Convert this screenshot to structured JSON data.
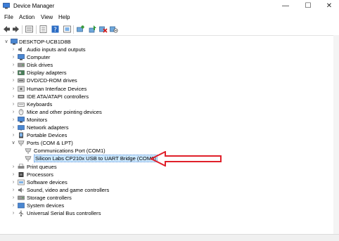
{
  "window": {
    "title": "Device Manager"
  },
  "menu": [
    "File",
    "Action",
    "View",
    "Help"
  ],
  "tree": {
    "root": "DESKTOP-UCB1D8B",
    "categories": [
      {
        "label": "Audio inputs and outputs",
        "icon": "speaker-icon"
      },
      {
        "label": "Computer",
        "icon": "computer-icon"
      },
      {
        "label": "Disk drives",
        "icon": "disk-drive-icon"
      },
      {
        "label": "Display adapters",
        "icon": "display-adapter-icon"
      },
      {
        "label": "DVD/CD-ROM drives",
        "icon": "dvd-drive-icon"
      },
      {
        "label": "Human Interface Devices",
        "icon": "hid-icon"
      },
      {
        "label": "IDE ATA/ATAPI controllers",
        "icon": "ide-controller-icon"
      },
      {
        "label": "Keyboards",
        "icon": "keyboard-icon"
      },
      {
        "label": "Mice and other pointing devices",
        "icon": "mouse-icon"
      },
      {
        "label": "Monitors",
        "icon": "monitor-icon"
      },
      {
        "label": "Network adapters",
        "icon": "network-adapter-icon"
      },
      {
        "label": "Portable Devices",
        "icon": "portable-device-icon"
      },
      {
        "label": "Ports (COM & LPT)",
        "icon": "port-icon"
      },
      {
        "label": "Print queues",
        "icon": "printer-icon"
      },
      {
        "label": "Processors",
        "icon": "processor-icon"
      },
      {
        "label": "Software devices",
        "icon": "software-device-icon"
      },
      {
        "label": "Sound, video and game controllers",
        "icon": "sound-icon"
      },
      {
        "label": "Storage controllers",
        "icon": "storage-icon"
      },
      {
        "label": "System devices",
        "icon": "system-device-icon"
      },
      {
        "label": "Universal Serial Bus controllers",
        "icon": "usb-icon"
      }
    ],
    "ports_children": [
      {
        "label": "Communications Port (COM1)",
        "icon": "port-connector-icon"
      },
      {
        "label": "Silicon Labs CP210x USB to UART Bridge (COM6)",
        "icon": "port-connector-icon"
      }
    ]
  },
  "colors": {
    "selection": "#cce8ff",
    "annotation_arrow": "#e0202a"
  }
}
